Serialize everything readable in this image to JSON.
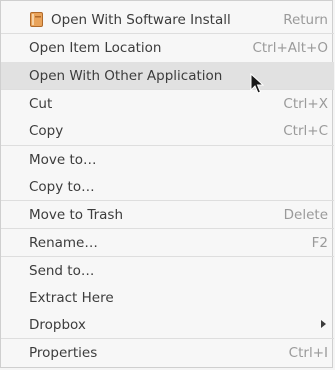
{
  "menu": {
    "items": [
      {
        "label": "Open With Software Install",
        "accel": "Return",
        "icon": "software-install-icon"
      },
      {
        "label": "Open Item Location",
        "accel": "Ctrl+Alt+O"
      },
      {
        "label": "Open With Other Application",
        "accel": ""
      },
      {
        "label": "Cut",
        "accel": "Ctrl+X"
      },
      {
        "label": "Copy",
        "accel": "Ctrl+C"
      },
      {
        "label": "Move to…",
        "accel": ""
      },
      {
        "label": "Copy to…",
        "accel": ""
      },
      {
        "label": "Move to Trash",
        "accel": "Delete"
      },
      {
        "label": "Rename…",
        "accel": "F2"
      },
      {
        "label": "Send to…",
        "accel": ""
      },
      {
        "label": "Extract Here",
        "accel": ""
      },
      {
        "label": "Dropbox",
        "accel": "",
        "submenu": true
      },
      {
        "label": "Properties",
        "accel": "Ctrl+I"
      }
    ],
    "highlighted_item": "Open With Other Application"
  },
  "colors": {
    "menu_background": "#f7f7f7",
    "highlight": "#e1e1e1",
    "text": "#3c3c3c",
    "accelerator_text": "#9a9a9a",
    "separator": "#dedede"
  }
}
